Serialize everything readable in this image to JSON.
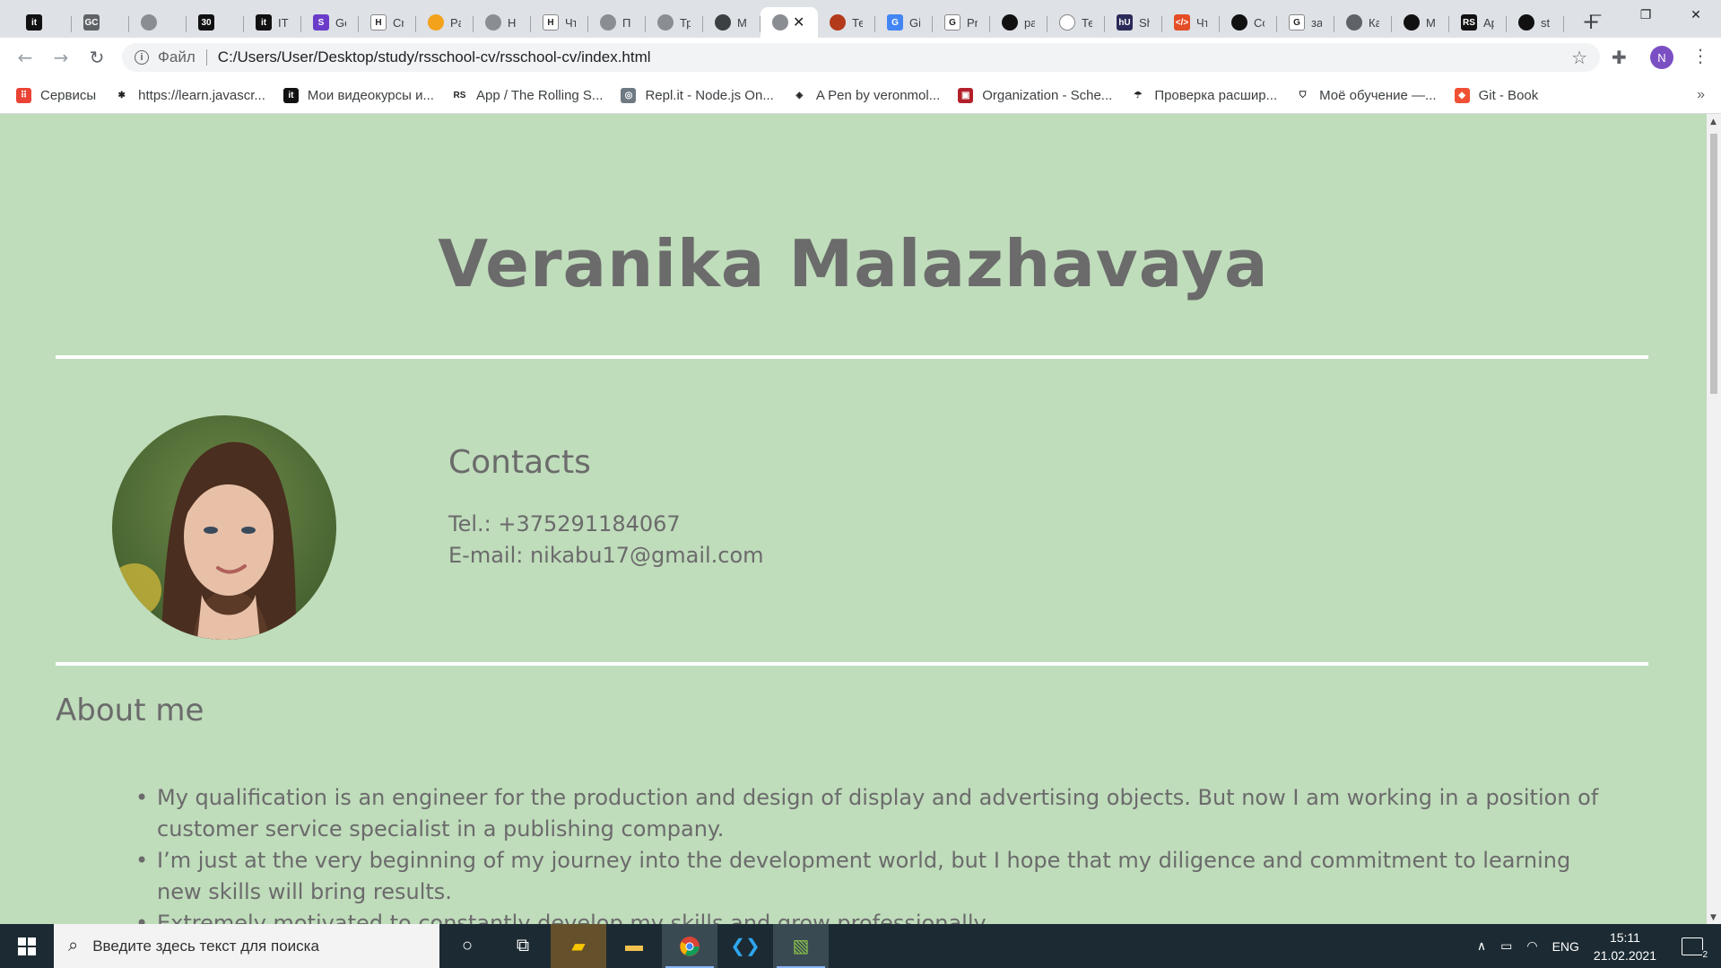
{
  "browser": {
    "tabs": [
      {
        "icon": "it-icon",
        "label": "",
        "bg": "#111111",
        "glyph": "it"
      },
      {
        "icon": "globe-icon",
        "label": "",
        "bg": "#5f6368",
        "glyph": "GC"
      },
      {
        "icon": "globe-icon",
        "label": "",
        "bg": "#8a8e92",
        "glyph": ""
      },
      {
        "icon": "30-icon",
        "label": "",
        "bg": "#111111",
        "glyph": "30"
      },
      {
        "icon": "it-icon",
        "label": "IT",
        "bg": "#111111",
        "glyph": "it"
      },
      {
        "icon": "s-icon",
        "label": "Ge",
        "bg": "#6a3cc9",
        "glyph": "S"
      },
      {
        "icon": "h-icon",
        "label": "Cr",
        "bg": "#ffffff",
        "glyph": "Н"
      },
      {
        "icon": "cloud-icon",
        "label": "Pa",
        "bg": "#f3a21b",
        "glyph": ""
      },
      {
        "icon": "globe-icon",
        "label": "H",
        "bg": "#8a8e92",
        "glyph": ""
      },
      {
        "icon": "h-icon",
        "label": "Чт",
        "bg": "#ffffff",
        "glyph": "Н"
      },
      {
        "icon": "globe-icon",
        "label": "П",
        "bg": "#8a8e92",
        "glyph": ""
      },
      {
        "icon": "globe-icon",
        "label": "Тр",
        "bg": "#8a8e92",
        "glyph": ""
      },
      {
        "icon": "chrome-icon",
        "label": "M",
        "bg": "#3c4043",
        "glyph": ""
      },
      {
        "icon": "globe-icon",
        "label": "",
        "bg": "#8a8e92",
        "glyph": "",
        "active": true
      },
      {
        "icon": "blocks-icon",
        "label": "Те",
        "bg": "#b33a1a",
        "glyph": ""
      },
      {
        "icon": "translate-icon",
        "label": "Gi",
        "bg": "#4285f4",
        "glyph": "G"
      },
      {
        "icon": "google-icon",
        "label": "Pr",
        "bg": "#ffffff",
        "glyph": "G"
      },
      {
        "icon": "bookmark-icon",
        "label": "ра",
        "bg": "#111111",
        "glyph": ""
      },
      {
        "icon": "shield-icon",
        "label": "Те",
        "bg": "#ffffff",
        "glyph": ""
      },
      {
        "icon": "hu-icon",
        "label": "Sh",
        "bg": "#2b2b5a",
        "glyph": "hU"
      },
      {
        "icon": "code-icon",
        "label": "Чт",
        "bg": "#e44d26",
        "glyph": "</>"
      },
      {
        "icon": "github-icon",
        "label": "Co",
        "bg": "#111111",
        "glyph": ""
      },
      {
        "icon": "google-icon",
        "label": "за",
        "bg": "#ffffff",
        "glyph": "G"
      },
      {
        "icon": "diamond-icon",
        "label": "Ка",
        "bg": "#5f6368",
        "glyph": ""
      },
      {
        "icon": "github-icon",
        "label": "M",
        "bg": "#111111",
        "glyph": ""
      },
      {
        "icon": "rs-icon",
        "label": "Ap",
        "bg": "#111111",
        "glyph": "RS"
      },
      {
        "icon": "github-icon",
        "label": "st",
        "bg": "#111111",
        "glyph": ""
      }
    ],
    "new_tab": "+",
    "window_controls": {
      "minimize": "—",
      "restore": "❐",
      "close": "✕"
    },
    "address": {
      "prefix": "Файл",
      "url": "C:/Users/User/Desktop/study/rsschool-cv/rsschool-cv/index.html"
    },
    "profile_initial": "N",
    "bookmarks": [
      {
        "label": "Сервисы",
        "icon": "apps-grid-icon",
        "bg": "#ea4335",
        "glyph": "⠿"
      },
      {
        "label": "https://learn.javascr...",
        "icon": "js-man-icon",
        "bg": "#ffffff",
        "glyph": "✱"
      },
      {
        "label": "Мои видеокурсы и...",
        "icon": "it-icon",
        "bg": "#111111",
        "glyph": "it"
      },
      {
        "label": "App / The Rolling S...",
        "icon": "rs-icon",
        "bg": "#ffffff",
        "glyph": "RS"
      },
      {
        "label": "Repl.it - Node.js On...",
        "icon": "replit-icon",
        "bg": "#6e7a83",
        "glyph": "◎"
      },
      {
        "label": "A Pen by veronmol...",
        "icon": "codepen-icon",
        "bg": "#ffffff",
        "glyph": "◈"
      },
      {
        "label": "Organization - Sche...",
        "icon": "schema-icon",
        "bg": "#b3202a",
        "glyph": "▣"
      },
      {
        "label": "Проверка расшир...",
        "icon": "check-icon",
        "bg": "#ffffff",
        "glyph": "☂"
      },
      {
        "label": "Моё обучение —...",
        "icon": "shield-icon",
        "bg": "#ffffff",
        "glyph": "⛉"
      },
      {
        "label": "Git - Book",
        "icon": "git-icon",
        "bg": "#f05033",
        "glyph": "◆"
      }
    ],
    "bookmarks_more": "»"
  },
  "page": {
    "title": "Veranika Malazhavaya",
    "contacts_heading": "Contacts",
    "tel": "Tel.: +375291184067",
    "email": "E-mail: nikabu17@gmail.com",
    "about_heading": "About me",
    "about_items": [
      "My qualification is an engineer for the production and design of display and advertising objects. But now I am working in a position of customer service specialist in a publishing company.",
      "I’m just at the very beginning of my journey into the development world, but I hope that my diligence and commitment to learning new skills will bring results.",
      "Extremely motivated to constantly develop my skills and grow professionally."
    ],
    "colors": {
      "background": "#bfdcbb",
      "text": "#6b6b6b",
      "rule": "#ffffff"
    }
  },
  "taskbar": {
    "search_placeholder": "Введите здесь текст для поиска",
    "language": "ENG",
    "time": "15:11",
    "date": "21.02.2021",
    "notification_count": "2"
  }
}
